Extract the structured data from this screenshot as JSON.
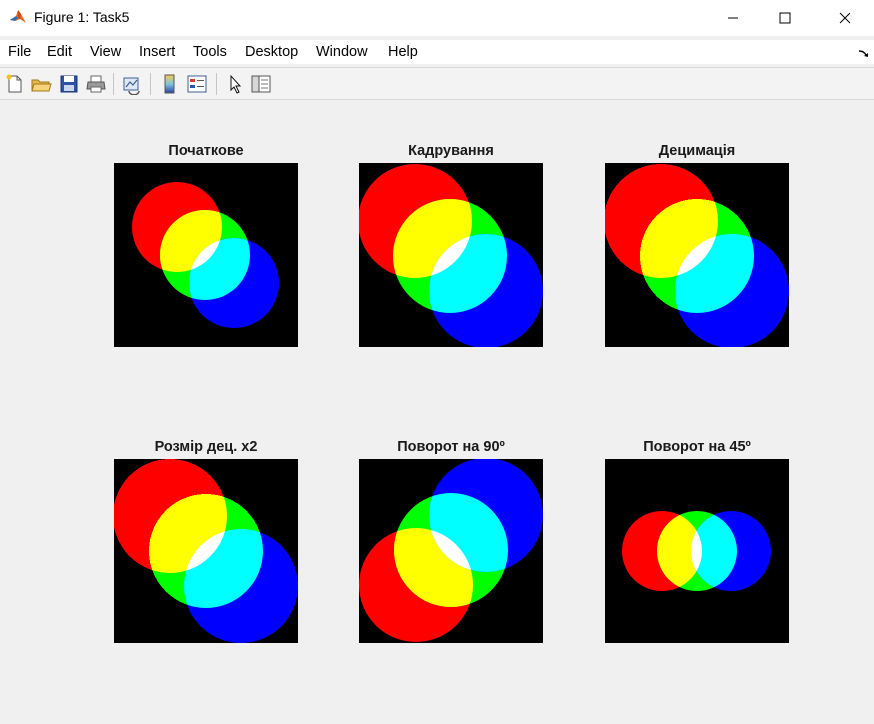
{
  "window": {
    "title": "Figure 1: Task5",
    "icon": "matlab-logo-icon",
    "controls": [
      "minimize-icon",
      "maximize-icon",
      "close-icon"
    ]
  },
  "menu": {
    "items": [
      "File",
      "Edit",
      "View",
      "Insert",
      "Tools",
      "Desktop",
      "Window",
      "Help"
    ]
  },
  "toolbar": {
    "buttons": [
      "new-figure-icon",
      "open-file-icon",
      "save-icon",
      "print-icon",
      "link-plot-icon",
      "insert-colorbar-icon",
      "insert-legend-icon",
      "edit-plot-icon",
      "property-inspector-icon"
    ]
  },
  "axes": [
    {
      "title": "Початкове"
    },
    {
      "title": "Кадрування"
    },
    {
      "title": "Децимація"
    },
    {
      "title": "Розмір дец. x2"
    },
    {
      "title": "Поворот на 90º"
    },
    {
      "title": "Поворот на 45º"
    }
  ],
  "colors": {
    "red": "#ff0000",
    "green": "#00ff00",
    "blue": "#0000ff",
    "yellow": "#ffff00",
    "cyan": "#00ffff",
    "white": "#ffffff",
    "background": "#000000"
  }
}
